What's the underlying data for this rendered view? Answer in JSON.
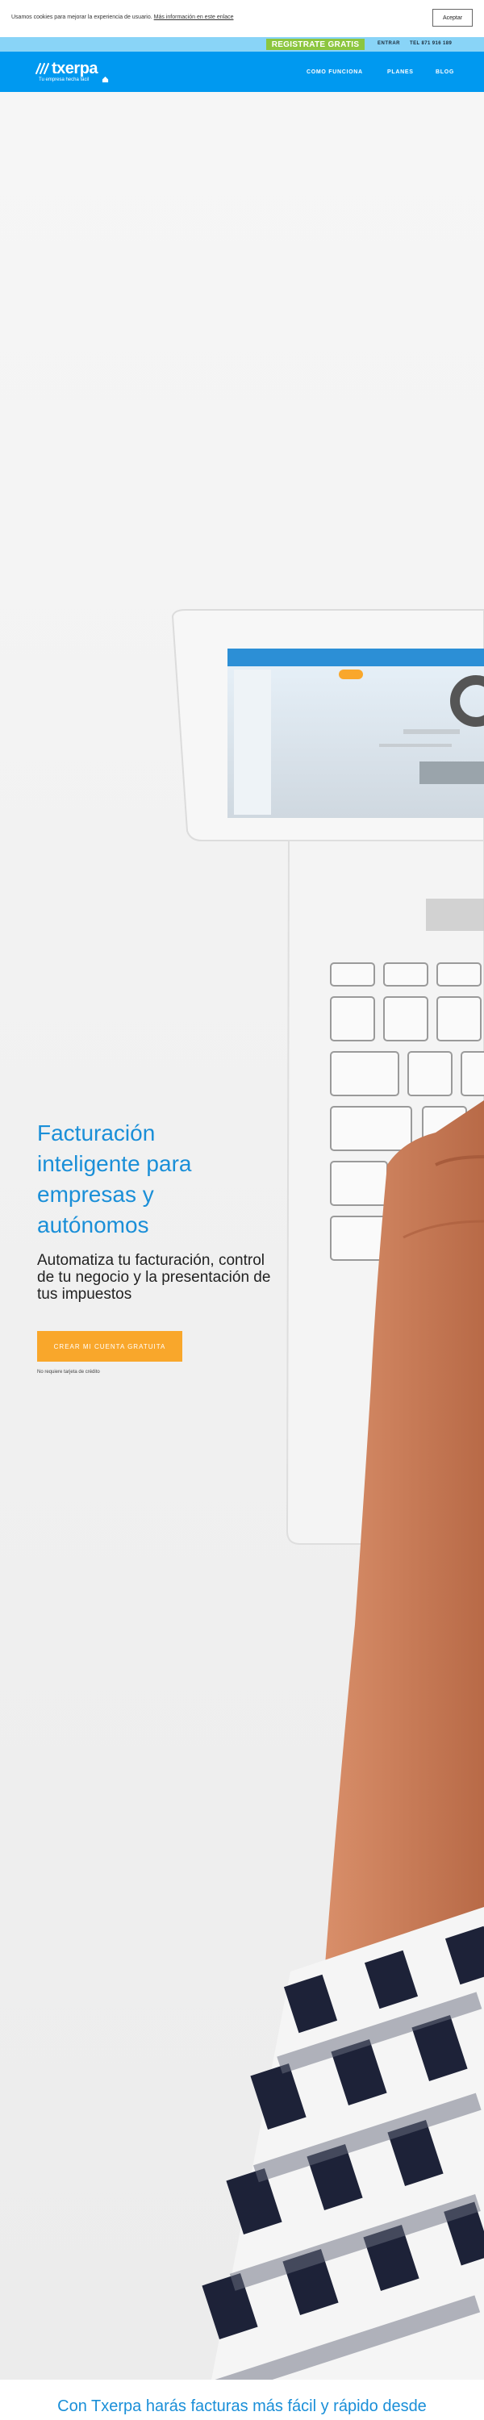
{
  "cookie_bar": {
    "text": "Usamos cookies para mejorar la experiencia de usuario.",
    "link": "Más información en este enlace",
    "accept_label": "Aceptar"
  },
  "topbar": {
    "register_label": "REGISTRATE GRATIS",
    "login_label": "ENTRAR",
    "phone": "TEL 871 916 189"
  },
  "nav": {
    "logo_text": "txerpa",
    "logo_tagline": "Tu empresa hecha fácil",
    "links": [
      "COMO FUNCIONA",
      "PLANES",
      "BLOG"
    ]
  },
  "hero": {
    "title": "Facturación inteligente para empresas y autónomos",
    "subtitle": "Automatiza tu facturación, control de tu negocio y la presentación de tus impuestos",
    "cta_label": "CREAR MI CUENTA GRATUITA",
    "cta_note": "No requiere tarjeta de crédito"
  },
  "bottom": {
    "heading": "Con Txerpa harás facturas más fácil y rápido desde"
  },
  "colors": {
    "brand_blue": "#0099f0",
    "topbar_blue": "#89d4f7",
    "register_green": "#8cc63f",
    "cta_orange": "#f9a72b",
    "title_blue": "#1a8fd8"
  },
  "icons": [
    "txerpa-logo-icon",
    "home-icon",
    "laptop-illustration",
    "hand-illustration"
  ]
}
